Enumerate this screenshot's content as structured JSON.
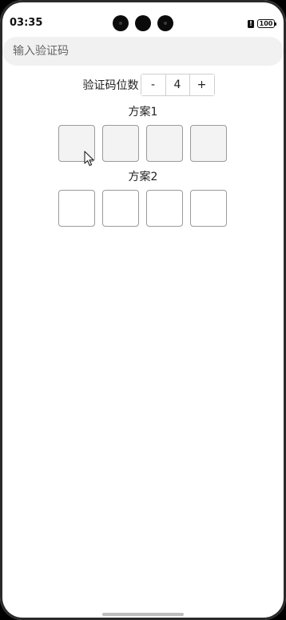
{
  "status_bar": {
    "time": "03:35",
    "alert_glyph": "!",
    "battery": "100"
  },
  "search": {
    "placeholder": "输入验证码",
    "value": ""
  },
  "digits": {
    "label": "验证码位数",
    "decrement_label": "-",
    "value": "4",
    "increment_label": "+"
  },
  "schemes": [
    {
      "title": "方案1",
      "boxes": [
        "",
        "",
        "",
        ""
      ]
    },
    {
      "title": "方案2",
      "boxes": [
        "",
        "",
        "",
        ""
      ]
    }
  ]
}
